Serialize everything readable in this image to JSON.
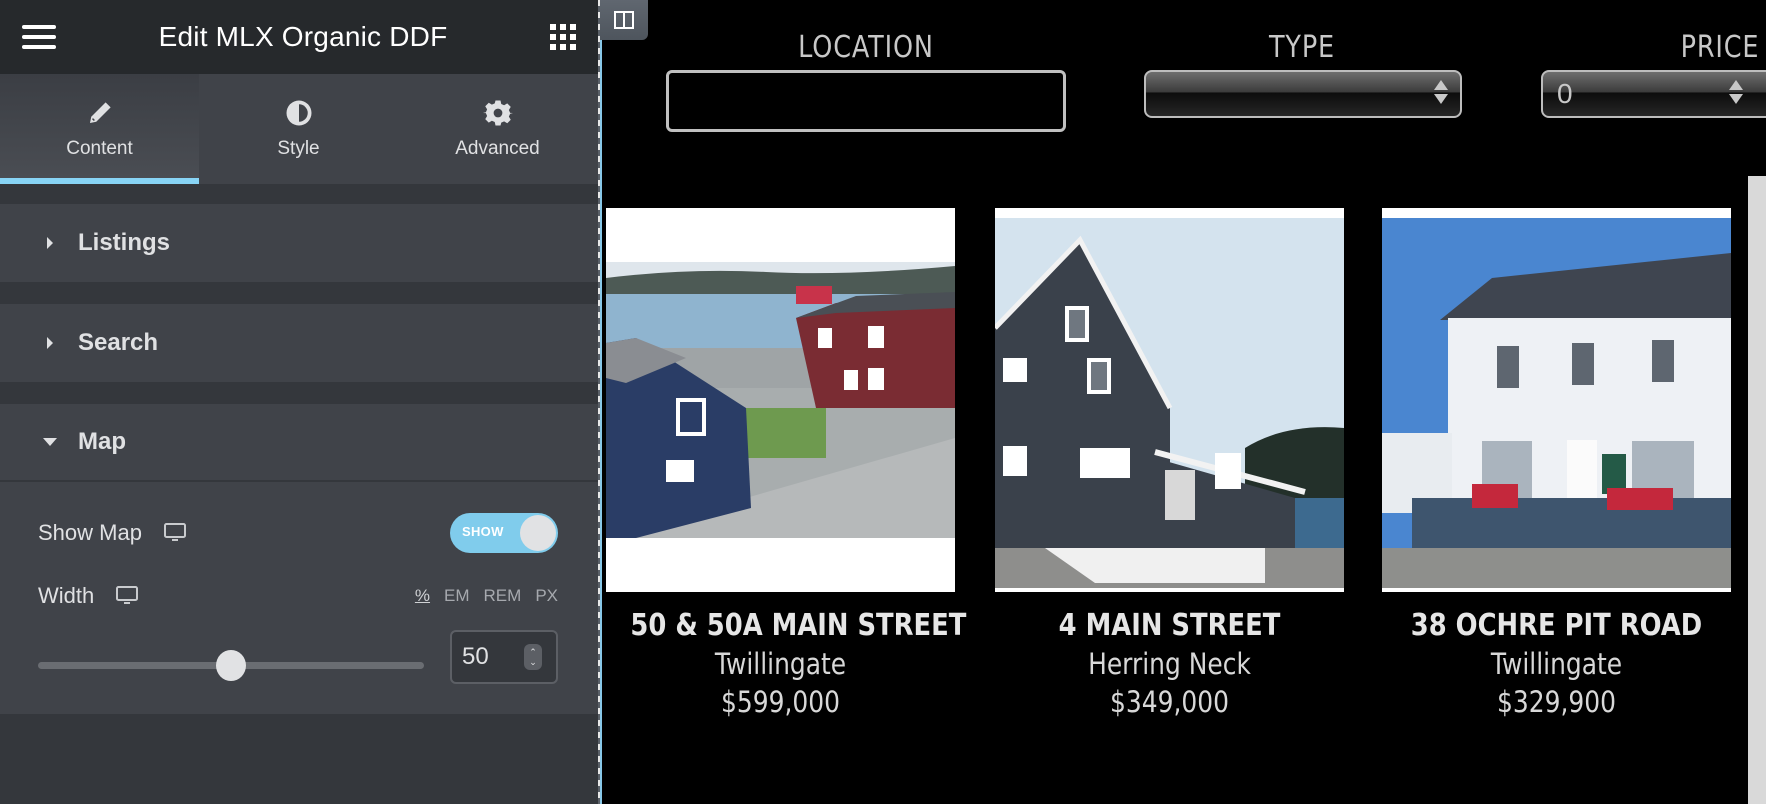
{
  "panel": {
    "title": "Edit MLX Organic DDF",
    "tabs": [
      {
        "label": "Content",
        "icon": "pencil-icon",
        "active": true
      },
      {
        "label": "Style",
        "icon": "half-circle-icon",
        "active": false
      },
      {
        "label": "Advanced",
        "icon": "gear-icon",
        "active": false
      }
    ],
    "sections": [
      {
        "label": "Listings",
        "expanded": false
      },
      {
        "label": "Search",
        "expanded": false
      },
      {
        "label": "Map",
        "expanded": true
      }
    ],
    "map": {
      "show_map_label": "Show Map",
      "show_map_toggle": "SHOW",
      "show_map_on": true,
      "width_label": "Width",
      "units": [
        "%",
        "EM",
        "REM",
        "PX"
      ],
      "active_unit": "%",
      "width_value": "50",
      "slider_fraction": 0.5
    }
  },
  "preview": {
    "filters": {
      "location_label": "LOCATION",
      "location_value": "",
      "type_label": "TYPE",
      "type_value": "",
      "price_label": "PRICE",
      "price_value": "0"
    },
    "listings": [
      {
        "address": "50 & 50A MAIN STREET",
        "city": "Twillingate",
        "price": "$599,000",
        "image": "aerial-harbour-buildings"
      },
      {
        "address": "4 MAIN STREET",
        "city": "Herring Neck",
        "price": "$349,000",
        "image": "dark-grey-house"
      },
      {
        "address": "38 OCHRE PIT ROAD",
        "city": "Twillingate",
        "price": "$329,900",
        "image": "white-house-red-chairs"
      }
    ]
  },
  "colors": {
    "accent": "#88d4f5",
    "panel_bg": "#404349",
    "header_bg": "#26292c",
    "preview_bg": "#000000"
  }
}
